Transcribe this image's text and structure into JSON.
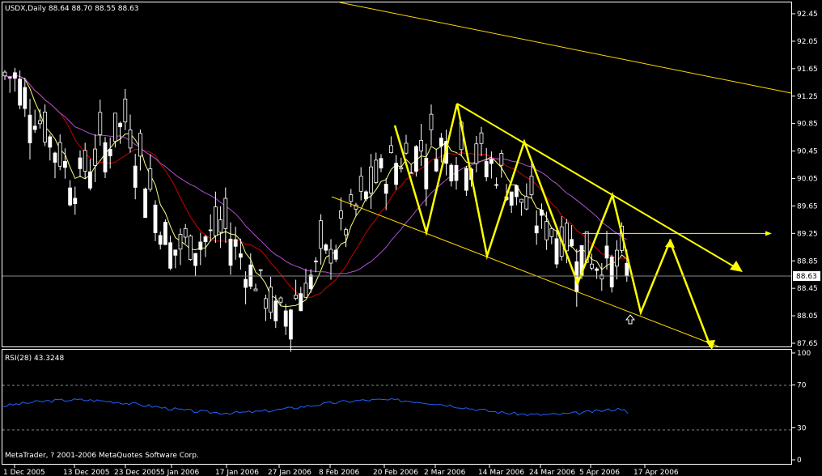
{
  "header": {
    "symbol_text": "USDX,Daily  88.64 88.70 88.55 88.63",
    "rsi_text": "RSI(28) 43.3248",
    "copyright": "MetaTrader, ? 2001-2006 MetaQuotes Software Corp."
  },
  "price_axis": {
    "ticks": [
      "92.45",
      "92.05",
      "91.65",
      "91.25",
      "90.85",
      "90.45",
      "90.05",
      "89.65",
      "89.25",
      "88.85",
      "88.45",
      "88.05",
      "87.65"
    ],
    "current_price": "88.63"
  },
  "rsi_axis": {
    "ticks": [
      "100",
      "70",
      "30",
      "0"
    ]
  },
  "date_axis": {
    "ticks": [
      "1 Dec 2005",
      "13 Dec 2005",
      "23 Dec 2005",
      "5 Jan 2006",
      "17 Jan 2006",
      "27 Jan 2006",
      "8 Feb 2006",
      "20 Feb 2006",
      "2 Mar 2006",
      "14 Mar 2006",
      "24 Mar 2006",
      "5 Apr 2006",
      "17 Apr 2006"
    ]
  },
  "colors": {
    "background": "#000000",
    "grid_frame": "#ffffff",
    "bull_candle": "#2f4f2f",
    "bear_candle": "#ffffff",
    "ma_fast": "#ffff80",
    "ma_mid": "#cc0000",
    "ma_slow": "#b050d0",
    "channel": "#ffd700",
    "pattern": "#ffff00",
    "rsi_line": "#2060ff"
  },
  "chart_data": {
    "type": "candlestick",
    "symbol": "USDX",
    "timeframe": "Daily",
    "ylim": [
      87.65,
      92.45
    ],
    "last_bar": {
      "open": 88.64,
      "high": 88.7,
      "low": 88.55,
      "close": 88.63
    },
    "dates": [
      "1 Dec 2005",
      "13 Dec 2005",
      "23 Dec 2005",
      "5 Jan 2006",
      "17 Jan 2006",
      "27 Jan 2006",
      "8 Feb 2006",
      "20 Feb 2006",
      "2 Mar 2006",
      "14 Mar 2006",
      "24 Mar 2006",
      "5 Apr 2006",
      "17 Apr 2006"
    ],
    "closes": [
      91.55,
      90.0,
      90.9,
      89.0,
      89.3,
      88.0,
      89.0,
      90.2,
      90.6,
      90.3,
      89.4,
      88.9,
      88.63
    ],
    "rsi": {
      "period": 28,
      "value": 43.3248,
      "ylim": [
        0,
        100
      ],
      "levels": [
        70,
        30
      ]
    },
    "zigzag_pattern": [
      {
        "date": "20 Feb 2006",
        "price": 90.85
      },
      {
        "date": "2 Mar 2006",
        "price": 89.3
      },
      {
        "date": "2 Mar 2006",
        "price": 91.15
      },
      {
        "date": "14 Mar 2006",
        "price": 88.95
      },
      {
        "date": "24 Mar 2006",
        "price": 90.65
      },
      {
        "date": "5 Apr 2006",
        "price": 88.55
      },
      {
        "date": "5 Apr 2006",
        "price": 89.85
      },
      {
        "date": "17 Apr 2006",
        "price": 88.05
      },
      {
        "date": "17 Apr 2006",
        "price": 89.15
      },
      {
        "date": "17 Apr 2006",
        "price": 87.65
      }
    ],
    "horizontal_level": 89.25
  }
}
